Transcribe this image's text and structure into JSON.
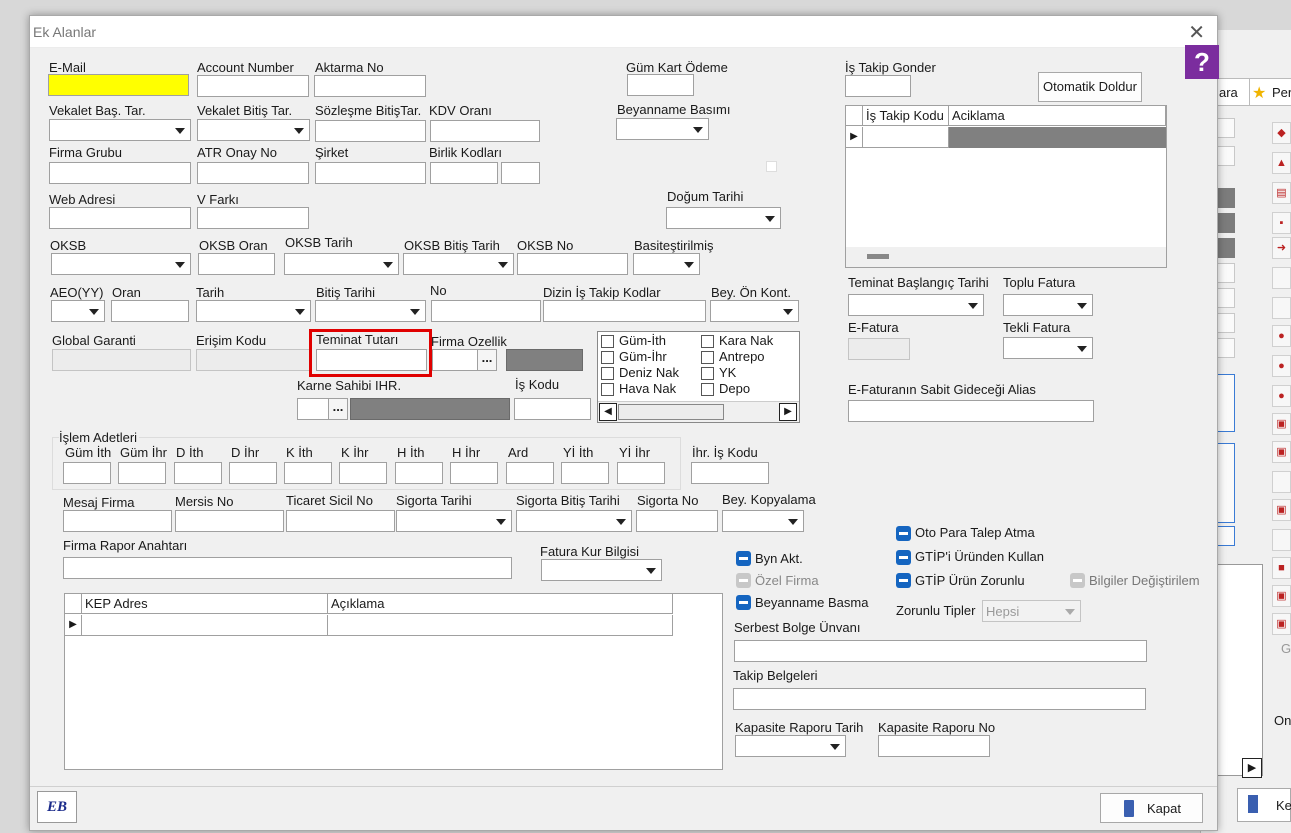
{
  "dialog": {
    "title": "Ek Alanlar"
  },
  "labels": {
    "email": "E-Mail",
    "account_number": "Account Number",
    "aktarma_no": "Aktarma No",
    "gum_kart_odeme": "Güm Kart Ödeme",
    "is_takip_gonder": "İş Takip Gonder",
    "vekalet_bas": "Vekalet Baş. Tar.",
    "vekalet_bitis": "Vekalet Bitiş Tar.",
    "sozlesme_bitis": "Sözleşme BitişTar.",
    "kdv_orani": "KDV Oranı",
    "beyanname_basimi": "Beyanname Basımı",
    "firma_grubu": "Firma Grubu",
    "atr_onay_no": "ATR Onay No",
    "sirket": "Şirket",
    "birlik_kodlari": "Birlik Kodları",
    "web_adresi": "Web Adresi",
    "v_farki": "V Farkı",
    "dogum_tarihi": "Doğum Tarihi",
    "oksb": "OKSB",
    "oksb_oran": "OKSB Oran",
    "oksb_tarih": "OKSB Tarih",
    "oksb_bitis_tarih": "OKSB Bitiş Tarih",
    "oksb_no": "OKSB No",
    "basitestirilmis": "Basiteştirilmiş",
    "aeo_yy": "AEO(YY)",
    "oran": "Oran",
    "tarih": "Tarih",
    "bitis_tarihi": "Bitiş Tarihi",
    "no": "No",
    "dizin_is_takip": "Dizin İş Takip Kodlar",
    "bey_on_kont": "Bey. Ön Kont.",
    "global_garanti": "Global Garanti",
    "erisim_kodu": "Erişim Kodu",
    "teminat_tutari": "Teminat Tutarı",
    "firma_ozellik": "Firma Ozellik",
    "karne_sahibi": "Karne Sahibi IHR.",
    "is_kodu": "İş Kodu",
    "islem_adetleri": "İşlem Adetleri",
    "ihr_is_kodu": "İhr. İş Kodu",
    "mesaj_firma": "Mesaj Firma",
    "mersis_no": "Mersis No",
    "ticaret_sicil_no": "Ticaret Sicil No",
    "sigorta_tarihi": "Sigorta Tarihi",
    "sigorta_bitis_tarihi": "Sigorta Bitiş Tarihi",
    "sigorta_no": "Sigorta No",
    "bey_kopyalama": "Bey. Kopyalama",
    "firma_rapor_anahtari": "Firma Rapor Anahtarı",
    "fatura_kur_bilgisi": "Fatura Kur Bilgisi",
    "teminat_baslangic": "Teminat Başlangıç Tarihi",
    "toplu_fatura": "Toplu Fatura",
    "e_fatura": "E-Fatura",
    "tekli_fatura": "Tekli Fatura",
    "e_fatura_alias": "E-Faturanın Sabit Gideceği Alias",
    "serbest_bolge": "Serbest Bolge Ünvanı",
    "takip_belgeleri": "Takip Belgeleri",
    "kapasite_tarih": "Kapasite Raporu Tarih",
    "kapasite_no": "Kapasite Raporu No",
    "zorunlu_tipler": "Zorunlu Tipler"
  },
  "islem_columns": [
    "Güm İth",
    "Güm İhr",
    "D İth",
    "D İhr",
    "K İth",
    "K İhr",
    "H İth",
    "H İhr",
    "Ard",
    "Yİ İth",
    "Yİ İhr"
  ],
  "checklist": {
    "left": [
      "Güm-İth",
      "Güm-İhr",
      "Deniz Nak",
      "Hava Nak"
    ],
    "right": [
      "Kara Nak",
      "Antrepo",
      "YK",
      "Depo"
    ]
  },
  "toggles": {
    "oto_para": "Oto Para Talep Atma",
    "gtip_urunden": "GTİP'i Üründen Kullan",
    "gtip_zorunlu": "GTİP Ürün Zorunlu",
    "bilgiler_degistirilem": "Bilgiler Değiştirilem",
    "byn_akt": "Byn Akt.",
    "ozel_firma": "Özel Firma",
    "beyanname_basma": "Beyanname Basma"
  },
  "zorunlu_tipler_value": "Hepsi",
  "is_takip_grid": {
    "columns": [
      "İş Takip Kodu",
      "Aciklama"
    ]
  },
  "kep_grid": {
    "columns": [
      "KEP Adres",
      "Açıklama"
    ]
  },
  "buttons": {
    "otomatik_doldur": "Otomatik Doldur",
    "kapat": "Kapat",
    "ellipsis": "..."
  },
  "help_glyph": "?",
  "logo_text": "EB",
  "background": {
    "ara": "ara",
    "per": "Per",
    "on": "On",
    "g": "G",
    "ke": "Ke"
  },
  "colors": {
    "email_highlight": "#ffff00",
    "toggle_blue": "#1565c0",
    "highlight_box": "#e00000"
  }
}
